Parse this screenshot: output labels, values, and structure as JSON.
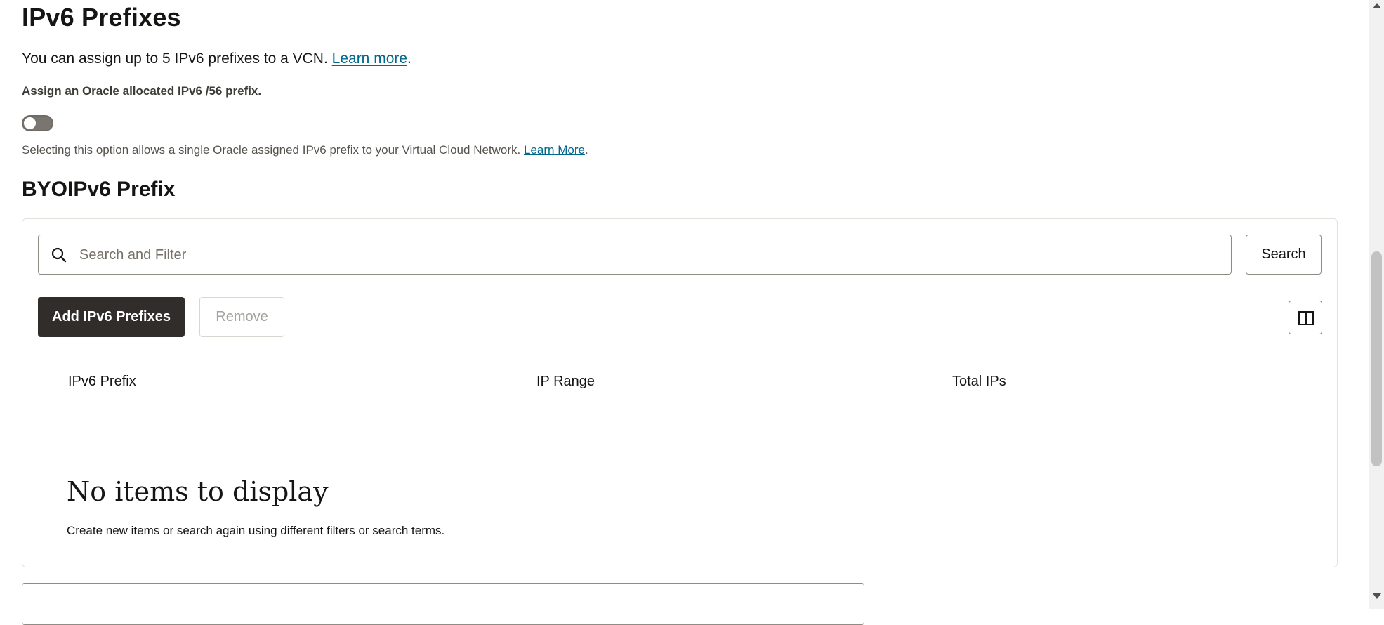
{
  "page": {
    "title": "IPv6 Prefixes",
    "intro_text": "You can assign up to 5 IPv6 prefixes to a VCN.",
    "intro_link": "Learn more",
    "assign_label": "Assign an Oracle allocated IPv6 /56 prefix.",
    "toggle_on": false,
    "help_text": "Selecting this option allows a single Oracle assigned IPv6 prefix to your Virtual Cloud Network.",
    "help_link": "Learn More"
  },
  "byoip": {
    "title": "BYOIPv6 Prefix",
    "search": {
      "placeholder": "Search and Filter",
      "value": "",
      "button_label": "Search",
      "icon": "search-icon"
    },
    "toolbar": {
      "add_label": "Add IPv6 Prefixes",
      "remove_label": "Remove",
      "columns_icon": "columns-icon"
    },
    "table": {
      "columns": [
        "IPv6 Prefix",
        "IP Range",
        "Total IPs"
      ],
      "rows": []
    },
    "empty": {
      "title": "No items to display",
      "subtitle": "Create new items or search again using different filters or search terms."
    }
  },
  "colors": {
    "primary_button": "#312d2a",
    "link": "#00688c",
    "toggle_off": "#7a766f"
  }
}
